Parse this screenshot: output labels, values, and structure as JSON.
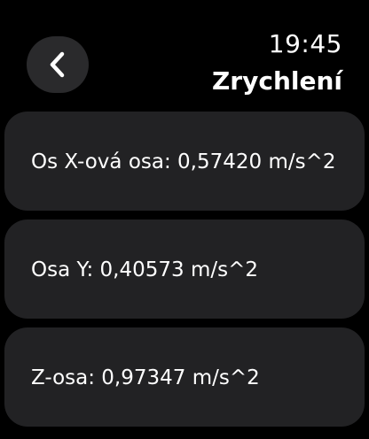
{
  "header": {
    "time": "19:45",
    "title": "Zrychlení",
    "back_icon": "chevron-left-icon"
  },
  "readings": [
    {
      "label": "Os X-ová osa: 0,57420 m/s^2"
    },
    {
      "label": "Osa Y: 0,40573 m/s^2"
    },
    {
      "label": "Z-osa: 0,97347 m/s^2"
    }
  ],
  "colors": {
    "background": "#000000",
    "card": "#222224",
    "button": "#2a2a2c",
    "text": "#ffffff"
  }
}
